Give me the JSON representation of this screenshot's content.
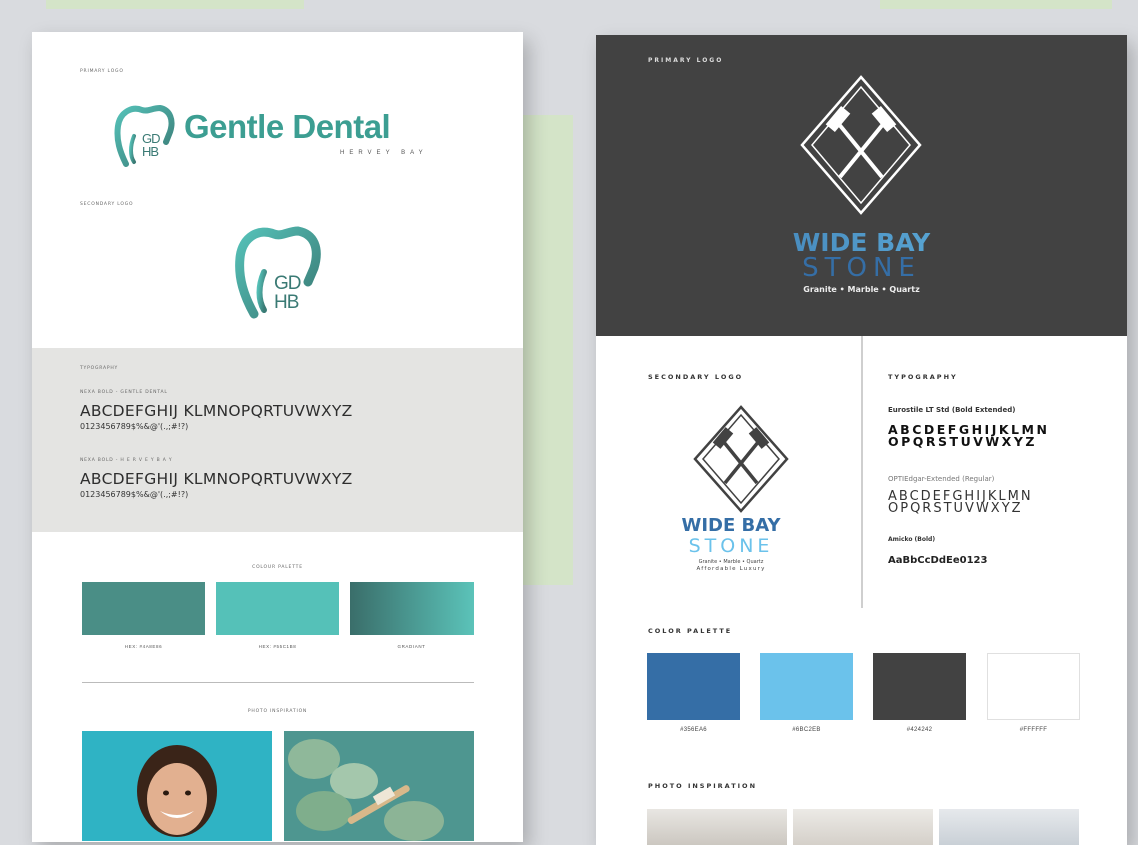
{
  "left": {
    "primary_logo_label": "PRIMARY LOGO",
    "wordmark": "Gentle Dental",
    "wordmark_sub": "HERVEY BAY",
    "monogram_top": "GD",
    "monogram_bottom": "HB",
    "secondary_logo_label": "SECONDARY LOGO",
    "typography_label": "TYPOGRAPHY",
    "font1_name": "NEXA BOLD - Gentle Dental",
    "font1_alpha": "ABCDEFGHIJ KLMNOPQRTUVWXYZ",
    "font1_nums": "0123456789$%&@'(.,;#!?)",
    "font2_name": "NEXA BOLD - H E R V E Y   B A Y",
    "font2_alpha": "ABCDEFGHIJ KLMNOPQRTUVWXYZ",
    "font2_nums": "0123456789$%&@'(.,;#!?)",
    "colour_palette_label": "COLOUR PALETTE",
    "swatches": [
      {
        "label": "HEX: #4A8E86",
        "color": "#4a8e86"
      },
      {
        "label": "HEX: #55C1B8",
        "color": "#55c1b8"
      },
      {
        "label": "GRADIANT",
        "color": "gradient"
      }
    ],
    "photo_inspiration_label": "PHOTO INSPIRATION"
  },
  "right": {
    "primary_logo_label": "PRIMARY LOGO",
    "brand_line1": "WIDE BAY",
    "brand_line2": "STONE",
    "tagline": "Granite • Marble • Quartz",
    "secondary_logo_label": "SECONDARY LOGO",
    "secondary_tagline1": "Granite • Marble • Quartz",
    "secondary_tagline2": "Affordable Luxury",
    "typography_label": "TYPOGRAPHY",
    "font1_name": "Eurostile LT Std (Bold Extended)",
    "font1_line1": "ABCDEFGHIJKLMN",
    "font1_line2": "OPQRSTUVWXYZ",
    "font2_name": "OPTIEdgar-Extended (Regular)",
    "font2_line1": "ABCDEFGHIJKLMN",
    "font2_line2": "OPQRSTUVWXYZ",
    "font3_name": "Amicko (Bold)",
    "font3_sample": "AaBbCcDdEe0123",
    "color_palette_label": "COLOR PALETTE",
    "swatches": [
      {
        "label": "#356EA6",
        "color": "#356ea6"
      },
      {
        "label": "#6BC2EB",
        "color": "#6bc2eb"
      },
      {
        "label": "#424242",
        "color": "#424242"
      },
      {
        "label": "#FFFFFF",
        "color": "#ffffff"
      }
    ],
    "photo_inspiration_label": "PHOTO INSPIRATION"
  }
}
